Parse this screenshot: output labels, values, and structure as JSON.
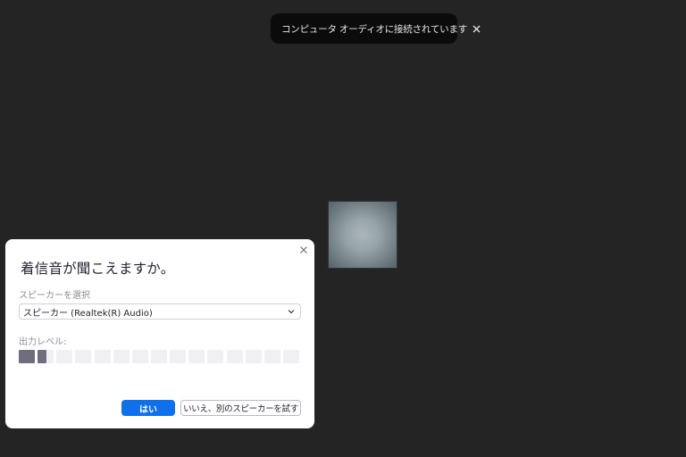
{
  "toast": {
    "message": "コンピュータ オーディオに接続されています",
    "close_icon": "close-icon"
  },
  "avatar": {
    "colors": [
      "#aab6ba",
      "#56636a"
    ]
  },
  "dialog": {
    "title": "着信音が聞こえますか。",
    "speaker_label": "スピーカーを選択",
    "speaker_selected": "スピーカー (Realtek(R) Audio)",
    "output_level_label": "出力レベル:",
    "output_level": {
      "segments_total": 15,
      "filled_segments": 1.5
    },
    "yes_label": "はい",
    "no_label": "いいえ、別のスピーカーを試す",
    "close_icon": "close-icon"
  },
  "colors": {
    "background": "#242424",
    "accent": "#0e71eb",
    "meter_fill": "#6e6e7e",
    "meter_empty": "#f0f0f4"
  }
}
